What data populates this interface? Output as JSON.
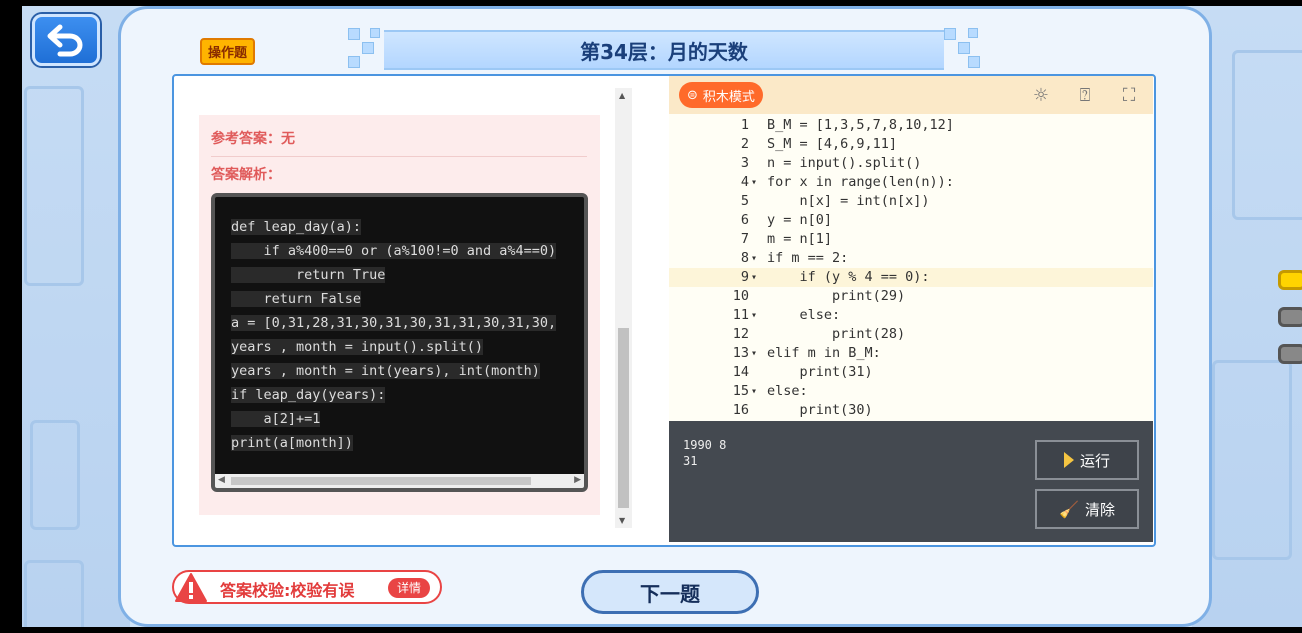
{
  "header": {
    "tag": "操作题",
    "title": "第34层：月的天数"
  },
  "answer": {
    "reference": "参考答案：无",
    "analysis": "答案解析："
  },
  "reference_code": [
    "def leap_day(a):",
    "    if a%400==0 or (a%100!=0 and a%4==0)",
    "        return True",
    "    return False",
    "a = [0,31,28,31,30,31,30,31,31,30,31,30,",
    "years , month = input().split()",
    "years , month = int(years), int(month)",
    "if leap_day(years):",
    "    a[2]+=1",
    "print(a[month])"
  ],
  "editor": {
    "mode_label": "积木模式",
    "lines": [
      {
        "n": "1",
        "fold": "",
        "text": "B_M = [1,3,5,7,8,10,12]"
      },
      {
        "n": "2",
        "fold": "",
        "text": "S_M = [4,6,9,11]"
      },
      {
        "n": "3",
        "fold": "",
        "text": "n = input().split()"
      },
      {
        "n": "4",
        "fold": "▾",
        "text": "for x in range(len(n)):"
      },
      {
        "n": "5",
        "fold": "",
        "text": "    n[x] = int(n[x])"
      },
      {
        "n": "6",
        "fold": "",
        "text": "y = n[0]"
      },
      {
        "n": "7",
        "fold": "",
        "text": "m = n[1]"
      },
      {
        "n": "8",
        "fold": "▾",
        "text": "if m == 2:"
      },
      {
        "n": "9",
        "fold": "▾",
        "text": "    if (y % 4 == 0):"
      },
      {
        "n": "10",
        "fold": "",
        "text": "        print(29)"
      },
      {
        "n": "11",
        "fold": "▾",
        "text": "    else:"
      },
      {
        "n": "12",
        "fold": "",
        "text": "        print(28)"
      },
      {
        "n": "13",
        "fold": "▾",
        "text": "elif m in B_M:"
      },
      {
        "n": "14",
        "fold": "",
        "text": "    print(31)"
      },
      {
        "n": "15",
        "fold": "▾",
        "text": "else:"
      },
      {
        "n": "16",
        "fold": "",
        "text": "    print(30)"
      }
    ],
    "active_line": 9,
    "console_output": "1990 8\n31",
    "run_label": "运行",
    "clear_label": "清除"
  },
  "footer": {
    "check_text": "答案校验:校验有误",
    "detail_label": "详情",
    "next_label": "下一题"
  },
  "colors": {
    "accent_orange": "#ff6a2a",
    "error_red": "#e94444",
    "title_blue": "#1a3f7a"
  }
}
